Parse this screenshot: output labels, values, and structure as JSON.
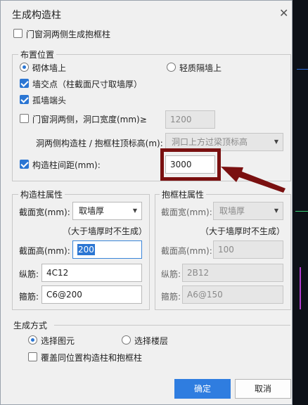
{
  "dialog": {
    "title": "生成构造柱",
    "close_glyph": "✕"
  },
  "door_window_frame_columns": {
    "label": "门窗洞两侧生成抱框柱",
    "checked": false
  },
  "placement": {
    "group_title": "布置位置",
    "masonry_wall": {
      "label": "砌体墙上",
      "selected": true
    },
    "light_partition": {
      "label": "轻质隔墙上",
      "selected": false
    },
    "wall_intersection": {
      "label": "墙交点（柱截面尺寸取墙厚）",
      "checked": true
    },
    "isolated_wall_end": {
      "label": "孤墙端头",
      "checked": true
    },
    "opening_sides": {
      "label": "门窗洞两侧，洞口宽度(mm)≥",
      "checked": false,
      "value": "1200"
    },
    "top_elevation": {
      "label": "洞两侧构造柱 / 抱框柱顶标高(m):",
      "value": "洞口上方过梁顶标高"
    },
    "column_spacing": {
      "label": "构造柱间距(mm):",
      "checked": true,
      "value": "3000"
    }
  },
  "constructional_column": {
    "group_title": "构造柱属性",
    "width_label": "截面宽(mm):",
    "width_value": "取墙厚",
    "note": "（大于墙厚时不生成）",
    "height_label": "截面高(mm):",
    "height_value": "200",
    "longitudinal_label": "纵筋:",
    "longitudinal_value": "4C12",
    "stirrup_label": "箍筋:",
    "stirrup_value": "C6@200"
  },
  "frame_column": {
    "group_title": "抱框柱属性",
    "width_label": "截面宽(mm):",
    "width_value": "取墙厚",
    "note": "（大于墙厚时不生成）",
    "height_label": "截面高(mm):",
    "height_value": "100",
    "longitudinal_label": "纵筋:",
    "longitudinal_value": "2B12",
    "stirrup_label": "箍筋:",
    "stirrup_value": "A6@150"
  },
  "generation": {
    "group_title": "生成方式",
    "select_elements": {
      "label": "选择图元",
      "selected": true
    },
    "select_floors": {
      "label": "选择楼层",
      "selected": false
    },
    "overwrite": {
      "label": "覆盖同位置构造柱和抱框柱",
      "checked": false
    }
  },
  "buttons": {
    "ok": "确定",
    "cancel": "取消"
  },
  "colors": {
    "accent": "#2b76d3",
    "annotation": "#7a1010"
  }
}
